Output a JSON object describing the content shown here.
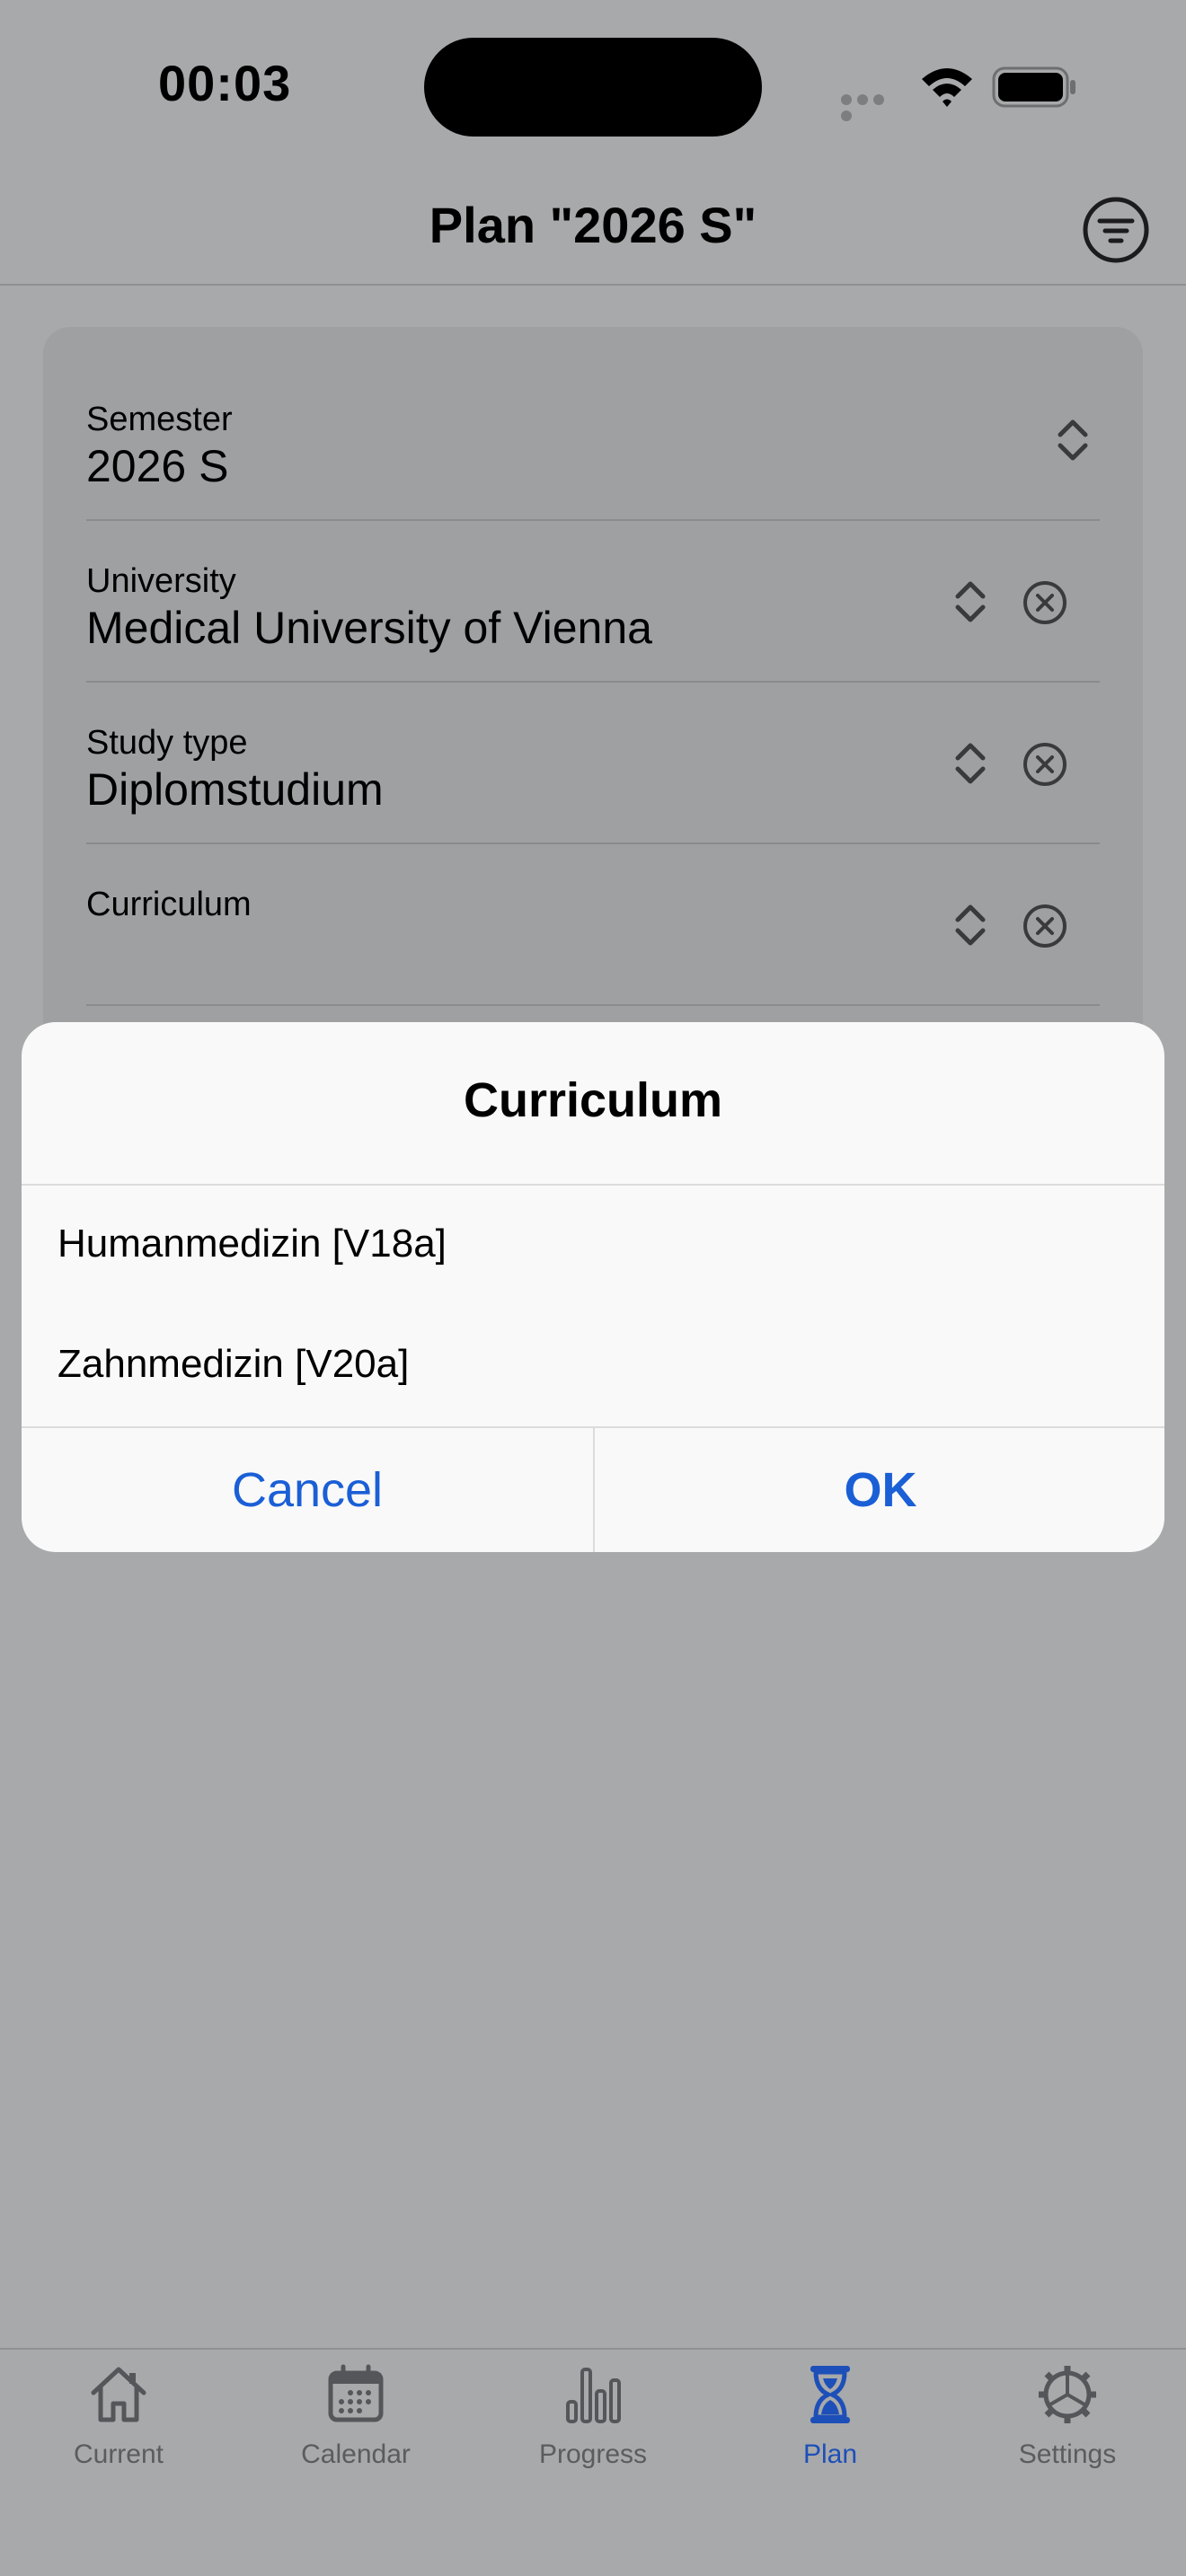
{
  "status_bar": {
    "time": "00:03"
  },
  "header": {
    "title": "Plan \"2026 S\"",
    "filter_icon": "filter-icon"
  },
  "form": {
    "rows": [
      {
        "label": "Semester",
        "value": "2026 S",
        "clearable": false
      },
      {
        "label": "University",
        "value": "Medical University of Vienna",
        "clearable": true
      },
      {
        "label": "Study type",
        "value": "Diplomstudium",
        "clearable": true
      },
      {
        "label": "Curriculum",
        "value": "",
        "clearable": true
      }
    ]
  },
  "dialog": {
    "title": "Curriculum",
    "options": [
      "Humanmedizin [V18a]",
      "Zahnmedizin [V20a]"
    ],
    "cancel_label": "Cancel",
    "ok_label": "OK"
  },
  "tabbar": {
    "items": [
      {
        "label": "Current",
        "icon": "house-icon",
        "active": false
      },
      {
        "label": "Calendar",
        "icon": "calendar-icon",
        "active": false
      },
      {
        "label": "Progress",
        "icon": "bar-chart-icon",
        "active": false
      },
      {
        "label": "Plan",
        "icon": "hourglass-icon",
        "active": true
      },
      {
        "label": "Settings",
        "icon": "gear-icon",
        "active": false
      }
    ]
  },
  "colors": {
    "accent": "#1a5fd6",
    "active_tab": "#1d4fb8",
    "dim_background": "#a8a9ab",
    "dialog_background": "#f9f9f9"
  }
}
